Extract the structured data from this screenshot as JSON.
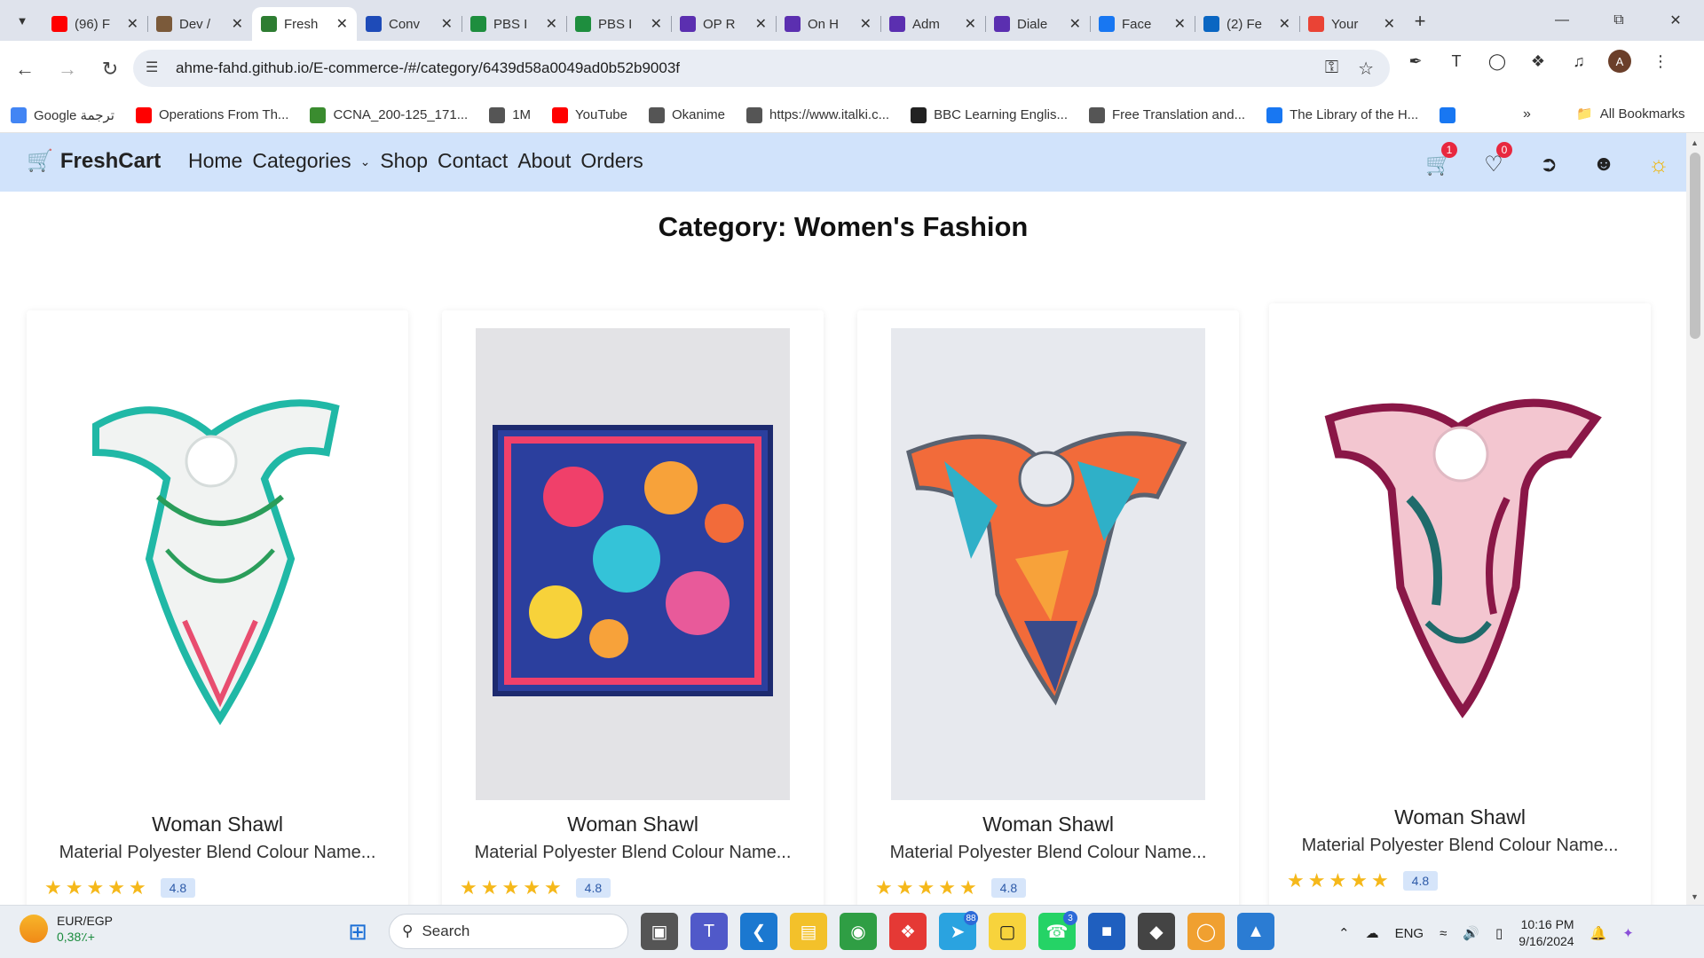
{
  "browser": {
    "tabs": [
      {
        "title": "(96) F",
        "icon": "youtube-icon",
        "color": "#ff0000",
        "active": false
      },
      {
        "title": "Dev /",
        "icon": "avatar-icon",
        "color": "#7b5a3a",
        "active": false
      },
      {
        "title": "Fresh",
        "icon": "cart-icon",
        "color": "#2e7d32",
        "active": true
      },
      {
        "title": "Conv",
        "icon": "copilot-icon",
        "color": "#1e4bb8",
        "active": false
      },
      {
        "title": "PBS I",
        "icon": "sheets-icon",
        "color": "#1e8e3e",
        "active": false
      },
      {
        "title": "PBS I",
        "icon": "sheets-icon",
        "color": "#1e8e3e",
        "active": false
      },
      {
        "title": "OP R",
        "icon": "forms-icon",
        "color": "#5b2fb0",
        "active": false
      },
      {
        "title": "On H",
        "icon": "forms-icon",
        "color": "#5b2fb0",
        "active": false
      },
      {
        "title": "Adm",
        "icon": "forms-icon",
        "color": "#5b2fb0",
        "active": false
      },
      {
        "title": "Diale",
        "icon": "forms-icon",
        "color": "#5b2fb0",
        "active": false
      },
      {
        "title": "Face",
        "icon": "facebook-icon",
        "color": "#1877f2",
        "active": false
      },
      {
        "title": "(2) Fe",
        "icon": "linkedin-icon",
        "color": "#0a66c2",
        "active": false
      },
      {
        "title": "Your",
        "icon": "gmail-icon",
        "color": "#ea4335",
        "active": false
      }
    ],
    "url": "ahme-fahd.github.io/E-commerce-/#/category/6439d58a0049ad0b52b9003f",
    "bookmarks": [
      {
        "label": "Google ترجمة",
        "icon": "translate-icon",
        "color": "#4285f4"
      },
      {
        "label": "Operations From Th...",
        "icon": "youtube-icon",
        "color": "#ff0000"
      },
      {
        "label": "CCNA_200-125_171...",
        "icon": "download-icon",
        "color": "#3a8c2f"
      },
      {
        "label": "1M",
        "icon": "globe-icon",
        "color": "#555555"
      },
      {
        "label": "YouTube",
        "icon": "youtube-icon",
        "color": "#ff0000"
      },
      {
        "label": "Okanime",
        "icon": "globe-icon",
        "color": "#555555"
      },
      {
        "label": "https://www.italki.c...",
        "icon": "globe-icon",
        "color": "#555555"
      },
      {
        "label": "BBC Learning Englis...",
        "icon": "bbc-icon",
        "color": "#222222"
      },
      {
        "label": "Free Translation and...",
        "icon": "globe-icon",
        "color": "#555555"
      },
      {
        "label": "The Library of the H...",
        "icon": "facebook-icon",
        "color": "#1877f2"
      },
      {
        "label": "",
        "icon": "facebook-icon",
        "color": "#1877f2"
      }
    ],
    "all_bookmarks": "All Bookmarks"
  },
  "site": {
    "brand": "FreshCart",
    "nav": {
      "home": "Home",
      "categories": "Categories",
      "shop": "Shop",
      "contact": "Contact",
      "about": "About",
      "orders": "Orders"
    },
    "cart_count": "1",
    "wishlist_count": "0",
    "page_title": "Category: Women's Fashion",
    "accent_color": "#d1e3fb",
    "products": [
      {
        "name": "Woman Shawl",
        "description": "Material Polyester Blend Colour Name...",
        "rating": "4.8",
        "stars": 5,
        "image": "scarf-white-green"
      },
      {
        "name": "Woman Shawl",
        "description": "Material Polyester Blend Colour Name...",
        "rating": "4.8",
        "stars": 5,
        "image": "scarf-square-floral"
      },
      {
        "name": "Woman Shawl",
        "description": "Material Polyester Blend Colour Name...",
        "rating": "4.8",
        "stars": 5,
        "image": "scarf-geometric-orange"
      },
      {
        "name": "Woman Shawl",
        "description": "Material Polyester Blend Colour Name...",
        "rating": "4.8",
        "stars": 5,
        "image": "scarf-magenta-leaf"
      }
    ]
  },
  "taskbar": {
    "weather_title": "EUR/EGP",
    "weather_value": "0,38٪+",
    "search": "Search",
    "telegram_badge": "88",
    "whatsapp_badge": "3",
    "lang": "ENG",
    "time": "10:16 PM",
    "date": "9/16/2024"
  }
}
